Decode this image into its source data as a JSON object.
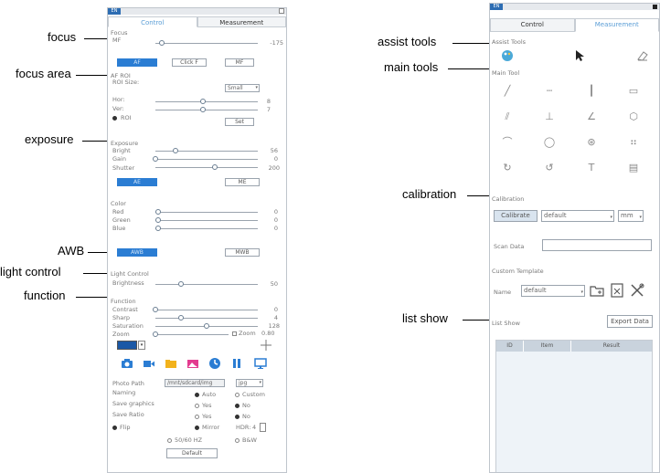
{
  "annotations": {
    "left": [
      "focus",
      "focus area",
      "exposure",
      "AWB",
      "light control",
      "function"
    ],
    "right": [
      "assist tools",
      "main tools",
      "calibration",
      "list show"
    ]
  },
  "left_panel": {
    "lang": "EN",
    "tabs": [
      "Control",
      "Measurement"
    ],
    "focus": {
      "title": "Focus",
      "mf_label": "MF",
      "mf_value": "-175",
      "mf_level": 0.06,
      "buttons": [
        "AF",
        "Click F",
        "MF"
      ]
    },
    "roi": {
      "title": "AF ROI",
      "size_label": "ROI Size:",
      "size_value": "Small",
      "hor_label": "Hor:",
      "hor_value": "8",
      "hor_level": 0.46,
      "ver_label": "Ver:",
      "ver_value": "7",
      "ver_level": 0.46,
      "roi_radio": "ROI",
      "set_button": "Set"
    },
    "exposure": {
      "title": "Exposure",
      "bright_label": "Bright",
      "bright_value": "56",
      "bright_level": 0.2,
      "gain_label": "Gain",
      "gain_value": "0",
      "gain_level": 0.0,
      "shutter_label": "Shutter",
      "shutter_value": "200",
      "shutter_level": 0.58,
      "ae_button": "AE",
      "me_button": "ME"
    },
    "color": {
      "title": "Color",
      "red_label": "Red",
      "red_value": "0",
      "green_label": "Green",
      "green_value": "0",
      "blue_label": "Blue",
      "blue_value": "0",
      "awb_button": "AWB",
      "mwb_button": "MWB"
    },
    "light": {
      "title": "Light Control",
      "brightness_label": "Brightness",
      "brightness_value": "50",
      "brightness_level": 0.25
    },
    "function": {
      "title": "Function",
      "contrast_label": "Contrast",
      "contrast_value": "0",
      "contrast_level": 0.0,
      "sharp_label": "Sharp",
      "sharp_value": "4",
      "sharp_level": 0.25,
      "saturation_label": "Saturation",
      "saturation_value": "128",
      "saturation_level": 0.5,
      "zoom_label": "Zoom",
      "zoom_check": "Zoom",
      "zoom_value": "0.80",
      "zoom_level": 0.0
    },
    "toolbar_icons": [
      "camera-icon",
      "video-icon",
      "folder-icon",
      "image-icon",
      "clock-icon",
      "pause-icon",
      "monitor-icon"
    ],
    "photo": {
      "path_label": "Photo Path",
      "path_value": "/mnt/sdcard/img",
      "format": "jpg",
      "naming_label": "Naming",
      "naming_auto": "Auto",
      "naming_custom": "Custom",
      "save_graphics_label": "Save graphics",
      "save_ratio_label": "Save Ratio",
      "yes": "Yes",
      "no": "No",
      "flip": "Flip",
      "mirror": "Mirror",
      "hdr_label": "HDR:",
      "hdr_value": "4",
      "hz": "50/60 HZ",
      "bw": "B&W",
      "default_button": "Default"
    },
    "colors": {
      "accent": "#2b7dd3"
    }
  },
  "right_panel": {
    "lang": "EN",
    "tabs": [
      "Control",
      "Measurement"
    ],
    "assist_title": "Assist Tools",
    "main_title": "Main Tool",
    "tools": [
      "╱",
      "┄",
      "┃",
      "▭",
      "⫽",
      "⊥",
      "∠",
      "⬡",
      "⌒",
      "◯",
      "⊛",
      "⠶",
      "↻",
      "↺",
      "T",
      "▤"
    ],
    "calibration": {
      "title": "Calibration",
      "button": "Calibrate",
      "select": "default",
      "unit": "mm"
    },
    "scan_label": "Scan Data",
    "custom": {
      "title": "Custom Template",
      "name_label": "Name",
      "name_value": "default"
    },
    "list": {
      "title": "List Show",
      "export_button": "Export Data",
      "columns": [
        "ID",
        "Item",
        "Result"
      ]
    }
  }
}
